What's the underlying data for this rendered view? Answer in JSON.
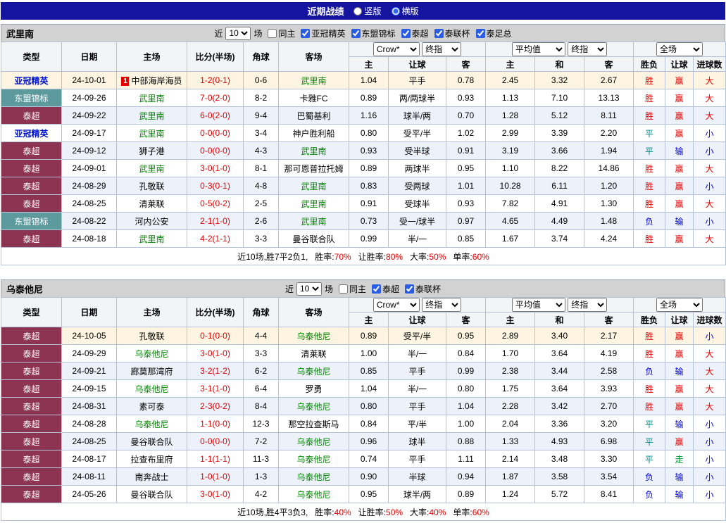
{
  "header": {
    "title": "近期战绩",
    "layout_options": [
      {
        "label": "竖版",
        "selected": false
      },
      {
        "label": "横版",
        "selected": true
      }
    ]
  },
  "columns": {
    "type": "类型",
    "date": "日期",
    "home": "主场",
    "score": "比分(半场)",
    "corners": "角球",
    "away": "客场",
    "odds_home": "主",
    "handicap": "让球",
    "odds_away": "客",
    "avg_home": "主",
    "avg_draw": "和",
    "avg_away": "客",
    "wdl": "胜负",
    "handicap_result": "让球",
    "goals": "进球数",
    "bookmaker_select": "Crow*",
    "final_odds_select": "终指",
    "average_select": "平均值",
    "final_odds_select2": "终指",
    "scope_select": "全场"
  },
  "sections": [
    {
      "team": "武里南",
      "filters": {
        "near_label": "近",
        "count": "10",
        "unit_label": "场",
        "same_home": {
          "label": "同主",
          "checked": false
        },
        "leagues": [
          {
            "label": "亚冠精英",
            "checked": true
          },
          {
            "label": "东盟锦标",
            "checked": true
          },
          {
            "label": "泰超",
            "checked": true
          },
          {
            "label": "泰联杯",
            "checked": true
          },
          {
            "label": "泰足总",
            "checked": true
          }
        ]
      },
      "rows": [
        {
          "type": "亚冠精英",
          "date": "24-10-01",
          "home": "中部海岸海员",
          "home_badge": "1",
          "score": "1-2(0-1)",
          "corners": "0-6",
          "away": "武里南",
          "odds_home": "1.04",
          "handicap": "平手",
          "odds_away": "0.78",
          "avg_home": "2.45",
          "avg_draw": "3.32",
          "avg_away": "2.67",
          "result_wdl": "胜",
          "result_handicap": "赢",
          "result_goals": "大"
        },
        {
          "type": "东盟锦标",
          "date": "24-09-26",
          "home": "武里南",
          "score": "7-0(2-0)",
          "corners": "8-2",
          "away": "卡雅FC",
          "odds_home": "0.89",
          "handicap": "两/两球半",
          "odds_away": "0.93",
          "avg_home": "1.13",
          "avg_draw": "7.10",
          "avg_away": "13.13",
          "result_wdl": "胜",
          "result_handicap": "赢",
          "result_goals": "大"
        },
        {
          "type": "泰超",
          "date": "24-09-22",
          "home": "武里南",
          "score": "6-0(2-0)",
          "corners": "9-4",
          "away": "巴蜀基利",
          "odds_home": "1.16",
          "handicap": "球半/两",
          "odds_away": "0.70",
          "avg_home": "1.28",
          "avg_draw": "5.12",
          "avg_away": "8.11",
          "result_wdl": "胜",
          "result_handicap": "赢",
          "result_goals": "大"
        },
        {
          "type": "亚冠精英",
          "date": "24-09-17",
          "home": "武里南",
          "score": "0-0(0-0)",
          "corners": "3-4",
          "away": "神户胜利船",
          "odds_home": "0.80",
          "handicap": "受平/半",
          "odds_away": "1.02",
          "avg_home": "2.99",
          "avg_draw": "3.39",
          "avg_away": "2.20",
          "result_wdl": "平",
          "result_handicap": "赢",
          "result_goals": "小"
        },
        {
          "type": "泰超",
          "date": "24-09-12",
          "home": "狮子港",
          "score": "0-0(0-0)",
          "corners": "4-3",
          "away": "武里南",
          "odds_home": "0.93",
          "handicap": "受半球",
          "odds_away": "0.91",
          "avg_home": "3.19",
          "avg_draw": "3.66",
          "avg_away": "1.94",
          "result_wdl": "平",
          "result_handicap": "输",
          "result_goals": "小"
        },
        {
          "type": "泰超",
          "date": "24-09-01",
          "home": "武里南",
          "score": "3-0(1-0)",
          "corners": "8-1",
          "away": "那可恩普拉托姆",
          "odds_home": "0.89",
          "handicap": "两球半",
          "odds_away": "0.95",
          "avg_home": "1.10",
          "avg_draw": "8.22",
          "avg_away": "14.86",
          "result_wdl": "胜",
          "result_handicap": "赢",
          "result_goals": "大"
        },
        {
          "type": "泰超",
          "date": "24-08-29",
          "home": "孔敬联",
          "score": "0-3(0-1)",
          "corners": "4-8",
          "away": "武里南",
          "odds_home": "0.83",
          "handicap": "受两球",
          "odds_away": "1.01",
          "avg_home": "10.28",
          "avg_draw": "6.11",
          "avg_away": "1.20",
          "result_wdl": "胜",
          "result_handicap": "赢",
          "result_goals": "小"
        },
        {
          "type": "泰超",
          "date": "24-08-25",
          "home": "清莱联",
          "score": "0-5(0-2)",
          "corners": "2-5",
          "away": "武里南",
          "odds_home": "0.91",
          "handicap": "受球半",
          "odds_away": "0.93",
          "avg_home": "7.82",
          "avg_draw": "4.91",
          "avg_away": "1.30",
          "result_wdl": "胜",
          "result_handicap": "赢",
          "result_goals": "大"
        },
        {
          "type": "东盟锦标",
          "date": "24-08-22",
          "home": "河内公安",
          "score": "2-1(1-0)",
          "corners": "2-6",
          "away": "武里南",
          "odds_home": "0.73",
          "handicap": "受一/球半",
          "odds_away": "0.97",
          "avg_home": "4.65",
          "avg_draw": "4.49",
          "avg_away": "1.48",
          "result_wdl": "负",
          "result_handicap": "输",
          "result_goals": "小"
        },
        {
          "type": "泰超",
          "date": "24-08-18",
          "home": "武里南",
          "score": "4-2(1-1)",
          "corners": "3-3",
          "away": "曼谷联合队",
          "odds_home": "0.99",
          "handicap": "半/一",
          "odds_away": "0.85",
          "avg_home": "1.67",
          "avg_draw": "3.74",
          "avg_away": "4.24",
          "result_wdl": "胜",
          "result_handicap": "赢",
          "result_goals": "大"
        }
      ],
      "summary": {
        "record": "近10场,胜7平2负1,",
        "stats": [
          {
            "label": "胜率:",
            "value": "70%"
          },
          {
            "label": "让胜率:",
            "value": "80%"
          },
          {
            "label": "大率:",
            "value": "50%"
          },
          {
            "label": "单率:",
            "value": "60%"
          }
        ]
      }
    },
    {
      "team": "乌泰他尼",
      "filters": {
        "near_label": "近",
        "count": "10",
        "unit_label": "场",
        "same_home": {
          "label": "同主",
          "checked": false
        },
        "leagues": [
          {
            "label": "泰超",
            "checked": true
          },
          {
            "label": "泰联杯",
            "checked": true
          }
        ]
      },
      "rows": [
        {
          "type": "泰超",
          "date": "24-10-05",
          "home": "孔敬联",
          "score": "0-1(0-0)",
          "corners": "4-4",
          "away": "乌泰他尼",
          "odds_home": "0.89",
          "handicap": "受平/半",
          "odds_away": "0.95",
          "avg_home": "2.89",
          "avg_draw": "3.40",
          "avg_away": "2.17",
          "result_wdl": "胜",
          "result_handicap": "赢",
          "result_goals": "小"
        },
        {
          "type": "泰超",
          "date": "24-09-29",
          "home": "乌泰他尼",
          "score": "3-0(1-0)",
          "corners": "3-3",
          "away": "清莱联",
          "odds_home": "1.00",
          "handicap": "半/一",
          "odds_away": "0.84",
          "avg_home": "1.70",
          "avg_draw": "3.64",
          "avg_away": "4.19",
          "result_wdl": "胜",
          "result_handicap": "赢",
          "result_goals": "大"
        },
        {
          "type": "泰超",
          "date": "24-09-21",
          "home": "廊莫那湾府",
          "score": "3-2(1-2)",
          "corners": "6-2",
          "away": "乌泰他尼",
          "odds_home": "0.85",
          "handicap": "平手",
          "odds_away": "0.99",
          "avg_home": "2.38",
          "avg_draw": "3.44",
          "avg_away": "2.58",
          "result_wdl": "负",
          "result_handicap": "输",
          "result_goals": "大"
        },
        {
          "type": "泰超",
          "date": "24-09-15",
          "home": "乌泰他尼",
          "score": "3-1(1-0)",
          "corners": "6-4",
          "away": "罗勇",
          "odds_home": "1.04",
          "handicap": "半/一",
          "odds_away": "0.80",
          "avg_home": "1.75",
          "avg_draw": "3.64",
          "avg_away": "3.93",
          "result_wdl": "胜",
          "result_handicap": "赢",
          "result_goals": "大"
        },
        {
          "type": "泰超",
          "date": "24-08-31",
          "home": "素可泰",
          "score": "2-3(0-2)",
          "corners": "8-4",
          "away": "乌泰他尼",
          "odds_home": "0.80",
          "handicap": "平手",
          "odds_away": "1.04",
          "avg_home": "2.28",
          "avg_draw": "3.42",
          "avg_away": "2.70",
          "result_wdl": "胜",
          "result_handicap": "赢",
          "result_goals": "大"
        },
        {
          "type": "泰超",
          "date": "24-08-28",
          "home": "乌泰他尼",
          "score": "1-1(0-0)",
          "corners": "12-3",
          "away": "那空拉查斯马",
          "odds_home": "0.84",
          "handicap": "平/半",
          "odds_away": "1.00",
          "avg_home": "2.04",
          "avg_draw": "3.36",
          "avg_away": "3.20",
          "result_wdl": "平",
          "result_handicap": "输",
          "result_goals": "小"
        },
        {
          "type": "泰超",
          "date": "24-08-25",
          "home": "曼谷联合队",
          "score": "0-0(0-0)",
          "corners": "7-2",
          "away": "乌泰他尼",
          "odds_home": "0.96",
          "handicap": "球半",
          "odds_away": "0.88",
          "avg_home": "1.33",
          "avg_draw": "4.93",
          "avg_away": "6.98",
          "result_wdl": "平",
          "result_handicap": "赢",
          "result_goals": "小"
        },
        {
          "type": "泰超",
          "date": "24-08-17",
          "home": "拉查布里府",
          "score": "1-1(1-1)",
          "corners": "11-3",
          "away": "乌泰他尼",
          "odds_home": "0.74",
          "handicap": "平手",
          "odds_away": "1.11",
          "avg_home": "2.14",
          "avg_draw": "3.48",
          "avg_away": "3.30",
          "result_wdl": "平",
          "result_handicap": "走",
          "result_goals": "小"
        },
        {
          "type": "泰超",
          "date": "24-08-11",
          "home": "南奔战士",
          "score": "1-0(1-0)",
          "corners": "1-3",
          "away": "乌泰他尼",
          "odds_home": "0.90",
          "handicap": "半球",
          "odds_away": "0.94",
          "avg_home": "1.87",
          "avg_draw": "3.58",
          "avg_away": "3.54",
          "result_wdl": "负",
          "result_handicap": "输",
          "result_goals": "小"
        },
        {
          "type": "泰超",
          "date": "24-05-26",
          "home": "曼谷联合队",
          "score": "3-0(1-0)",
          "corners": "4-2",
          "away": "乌泰他尼",
          "odds_home": "0.95",
          "handicap": "球半/两",
          "odds_away": "0.89",
          "avg_home": "1.24",
          "avg_draw": "5.72",
          "avg_away": "8.41",
          "result_wdl": "负",
          "result_handicap": "输",
          "result_goals": "小"
        }
      ],
      "summary": {
        "record": "近10场,胜4平3负3,",
        "stats": [
          {
            "label": "胜率:",
            "value": "40%"
          },
          {
            "label": "让胜率:",
            "value": "50%"
          },
          {
            "label": "大率:",
            "value": "40%"
          },
          {
            "label": "单率:",
            "value": "60%"
          }
        ]
      }
    }
  ]
}
